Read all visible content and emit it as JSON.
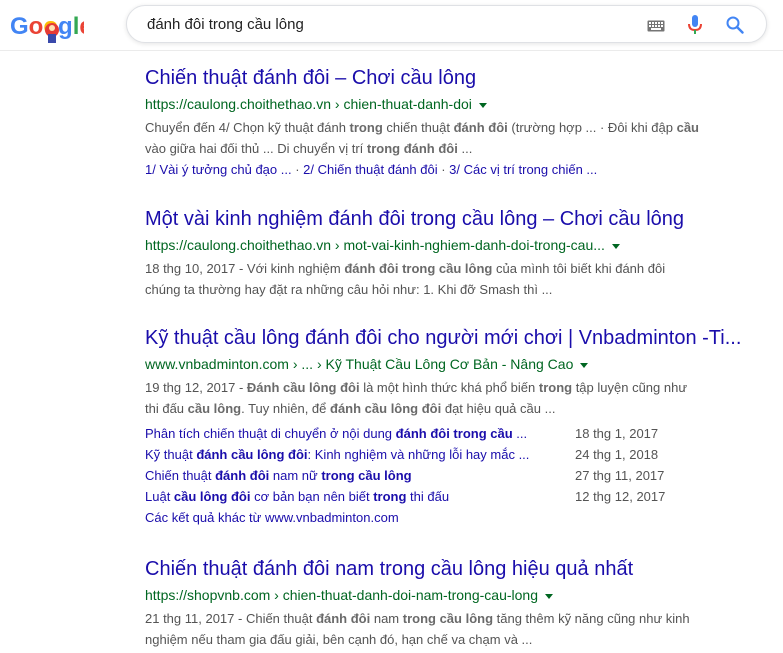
{
  "search": {
    "query": "đánh đôi trong cầu lông"
  },
  "logo": {
    "text": "Google"
  },
  "results": [
    {
      "title": "Chiến thuật đánh đôi – Chơi cầu lông",
      "url_domain": "https://caulong.choithethao.vn",
      "url_path": " › chien-thuat-danh-doi",
      "snippet_line1": [
        "Chuyển đến 4/ Chọn kỹ thuật đánh ",
        "trong",
        " chiến thuật ",
        "đánh đôi",
        " (trường hợp ... · Đôi khi đập ",
        "cầu"
      ],
      "snippet_line2": [
        "vào giữa hai đối thủ ... Di chuyển vị trí ",
        "trong đánh đôi",
        " ..."
      ],
      "sublinks": [
        "1/ Vài ý tưởng chủ đạo ...",
        "2/ Chiến thuật đánh đôi",
        "3/ Các vị trí trong chiến ..."
      ],
      "sublink_sep": " · "
    },
    {
      "title": "Một vài kinh nghiệm đánh đôi trong cầu lông – Chơi cầu lông",
      "url_domain": "https://caulong.choithethao.vn",
      "url_path": " › mot-vai-kinh-nghiem-danh-doi-trong-cau...",
      "snippet_line1": [
        "18 thg 10, 2017 - Với kinh nghiệm ",
        "đánh đôi trong cầu lông",
        " của mình tôi biết khi đánh đôi"
      ],
      "snippet_line2": [
        "chúng ta thường hay đặt ra những câu hỏi như: 1. Khi đỡ Smash thì ..."
      ]
    },
    {
      "title": "Kỹ thuật cầu lông đánh đôi cho người mới chơi | Vnbadminton -Ti...",
      "url_domain": "www.vnbadminton.com",
      "url_path": " › ... › Kỹ Thuật Cầu Lông Cơ Bản - Nâng Cao",
      "snippet_line1": [
        "19 thg 12, 2017 - ",
        "Đánh cầu lông đôi",
        " là một hình thức khá phổ biến ",
        "trong",
        " tập luyện cũng như"
      ],
      "snippet_line2": [
        "thi đấu ",
        "cầu lông",
        ". Tuy nhiên, để ",
        "đánh cầu lông đôi",
        " đạt hiệu quả cầu ..."
      ],
      "deep_links": [
        {
          "parts": [
            "Phân tích chiến thuật di chuyển ở nội dung ",
            "đánh đôi trong cầu",
            " ..."
          ],
          "date": "18 thg 1, 2017"
        },
        {
          "parts": [
            "Kỹ thuật ",
            "đánh cầu lông đôi",
            ": Kinh nghiệm và những lỗi hay mắc ..."
          ],
          "date": "24 thg 1, 2018"
        },
        {
          "parts": [
            "Chiến thuật ",
            "đánh đôi",
            " nam nữ ",
            "trong cầu lông",
            ""
          ],
          "date": "27 thg 11, 2017"
        },
        {
          "parts": [
            "Luật ",
            "cầu lông đôi",
            " cơ bản bạn nên biết ",
            "trong",
            " thi đấu"
          ],
          "date": "12 thg 12, 2017"
        }
      ],
      "more_results": "Các kết quả khác từ www.vnbadminton.com"
    },
    {
      "title": "Chiến thuật đánh đôi nam trong cầu lông hiệu quả nhất",
      "url_domain": "https://shopvnb.com",
      "url_path": " › chien-thuat-danh-doi-nam-trong-cau-long",
      "snippet_line1": [
        "21 thg 11, 2017 - Chiến thuật ",
        "đánh đôi",
        " nam ",
        "trong cầu lông",
        " tăng thêm kỹ năng cũng như kinh"
      ],
      "snippet_line2": [
        "nghiệm nếu tham gia đấu giải, bên cạnh đó, hạn chế va chạm và ..."
      ]
    }
  ]
}
